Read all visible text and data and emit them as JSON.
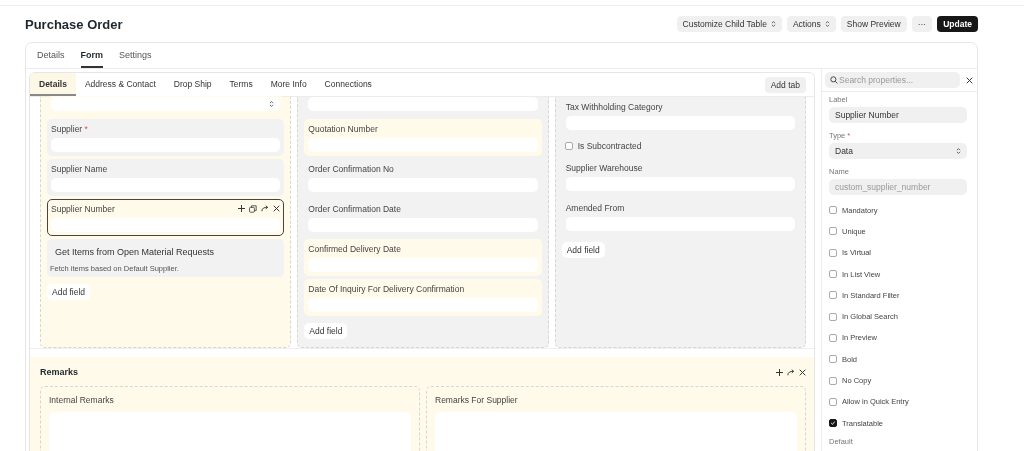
{
  "header": {
    "title": "Purchase Order",
    "buttons": [
      {
        "label": "Customize Child Table",
        "kind": "dropdown"
      },
      {
        "label": "Actions",
        "kind": "dropdown"
      },
      {
        "label": "Show Preview",
        "kind": "plain"
      },
      {
        "label": "···",
        "kind": "plain"
      },
      {
        "label": "Update",
        "kind": "primary"
      }
    ]
  },
  "page_tabs": [
    {
      "label": "Details",
      "selected": false
    },
    {
      "label": "Form",
      "selected": true
    },
    {
      "label": "Settings",
      "selected": false
    }
  ],
  "form_tabs": [
    {
      "label": "Details",
      "selected": true
    },
    {
      "label": "Address & Contact",
      "selected": false
    },
    {
      "label": "Drop Ship",
      "selected": false
    },
    {
      "label": "Terms",
      "selected": false
    },
    {
      "label": "More Info",
      "selected": false
    },
    {
      "label": "Connections",
      "selected": false
    }
  ],
  "add_tab": "Add tab",
  "columns": [
    {
      "selected": true,
      "add_field": "Add field",
      "fields": [
        {
          "kind": "select",
          "highlighted": true,
          "selected": false
        },
        {
          "kind": "data",
          "label": "Supplier",
          "required_mark": "*",
          "highlighted": false,
          "selected": false
        },
        {
          "kind": "data",
          "label": "Supplier Name",
          "highlighted": false,
          "selected": false
        },
        {
          "kind": "data",
          "label": "Supplier Number",
          "highlighted": true,
          "selected": true
        },
        {
          "kind": "button",
          "label": "Get Items from Open Material Requests",
          "description": "Fetch items based on Default Supplier.",
          "selected": false
        }
      ]
    },
    {
      "selected": false,
      "add_field": "Add field",
      "fields": [
        {
          "kind": "data",
          "highlighted": false,
          "selected": false
        },
        {
          "kind": "data",
          "label": "Quotation Number",
          "highlighted": true,
          "selected": false
        },
        {
          "kind": "data",
          "label": "Order Confirmation No",
          "highlighted": false,
          "selected": false
        },
        {
          "kind": "data",
          "label": "Order Confirmation Date",
          "highlighted": false,
          "selected": false
        },
        {
          "kind": "data",
          "label": "Confirmed Delivery Date",
          "highlighted": true,
          "selected": false
        },
        {
          "kind": "data",
          "label": "Date Of Inquiry For Delivery Confirmation",
          "highlighted": true,
          "selected": false
        }
      ]
    },
    {
      "selected": false,
      "add_field": "Add field",
      "fields": [
        {
          "kind": "data",
          "label": "Tax Withholding Category",
          "highlighted": false,
          "selected": false
        },
        {
          "kind": "check",
          "label": "Is Subcontracted",
          "selected": false
        },
        {
          "kind": "data",
          "label": "Supplier Warehouse",
          "highlighted": false,
          "selected": false
        },
        {
          "kind": "data",
          "label": "Amended From",
          "highlighted": false,
          "selected": false
        }
      ]
    }
  ],
  "remarks": {
    "title": "Remarks",
    "fields": [
      {
        "label": "Internal Remarks"
      },
      {
        "label": "Remarks For Supplier"
      }
    ]
  },
  "sidebar": {
    "search": {
      "placeholder": "Search properties..."
    },
    "label": {
      "label": "Label",
      "value": "Supplier Number"
    },
    "type": {
      "label": "Type",
      "required_mark": "*",
      "value": "Data"
    },
    "name": {
      "label": "Name",
      "value": "custom_supplier_number",
      "disabled": true
    },
    "checks": [
      {
        "label": "Mandatory",
        "checked": false
      },
      {
        "label": "Unique",
        "checked": false
      },
      {
        "label": "Is Virtual",
        "checked": false
      },
      {
        "label": "In List View",
        "checked": false
      },
      {
        "label": "In Standard Filter",
        "checked": false
      },
      {
        "label": "In Global Search",
        "checked": false
      },
      {
        "label": "In Preview",
        "checked": false
      },
      {
        "label": "Bold",
        "checked": false
      },
      {
        "label": "No Copy",
        "checked": false
      },
      {
        "label": "Allow in Quick Entry",
        "checked": false
      },
      {
        "label": "Translatable",
        "checked": true
      }
    ],
    "next_label": "Default"
  }
}
